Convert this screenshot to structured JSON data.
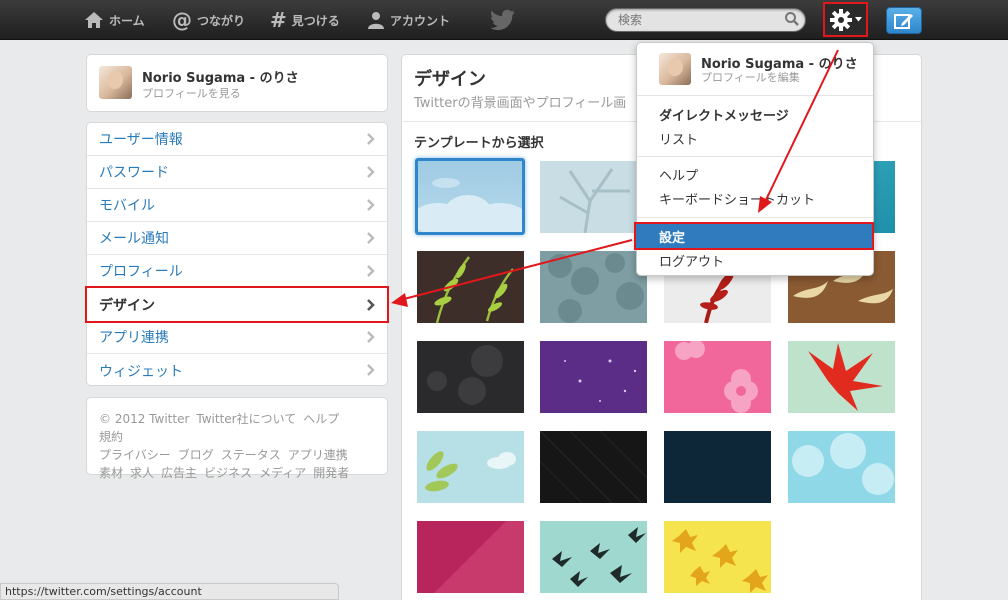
{
  "topbar": {
    "nav": [
      {
        "label": "ホーム",
        "icon": "home-icon"
      },
      {
        "label": "つながり",
        "icon": "at-icon"
      },
      {
        "label": "見つける",
        "icon": "hash-icon"
      },
      {
        "label": "アカウント",
        "icon": "person-icon"
      }
    ],
    "search_placeholder": "検索"
  },
  "profile": {
    "name": "Norio Sugama - のりさ",
    "view_profile": "プロフィールを見る",
    "edit_profile": "プロフィールを編集"
  },
  "settings_menu": [
    {
      "label": "ユーザー情報"
    },
    {
      "label": "パスワード"
    },
    {
      "label": "モバイル"
    },
    {
      "label": "メール通知"
    },
    {
      "label": "プロフィール"
    },
    {
      "label": "デザイン",
      "active": true
    },
    {
      "label": "アプリ連携"
    },
    {
      "label": "ウィジェット"
    }
  ],
  "footer_lines": [
    [
      "© 2012 Twitter",
      "Twitter社について",
      "ヘルプ",
      "規約"
    ],
    [
      "プライバシー",
      "ブログ",
      "ステータス",
      "アプリ連携"
    ],
    [
      "素材",
      "求人",
      "広告主",
      "ビジネス",
      "メディア",
      "開発者"
    ]
  ],
  "main": {
    "title": "デザイン",
    "subtitle": "Twitterの背景画面やプロフィール画",
    "section": "テンプレートから選択"
  },
  "dropdown": {
    "items": [
      {
        "label": "ダイレクトメッセージ",
        "bold": true
      },
      {
        "label": "リスト"
      },
      {
        "label": "ヘルプ"
      },
      {
        "label": "キーボードショートカット"
      },
      {
        "label": "設定",
        "highlighted": true
      },
      {
        "label": "ログアウト"
      }
    ]
  },
  "status_bar": "https://twitter.com/settings/account",
  "colors": {
    "accent": "#2f86cb",
    "link": "#2b7bb9",
    "annotation": "#e0181c"
  }
}
